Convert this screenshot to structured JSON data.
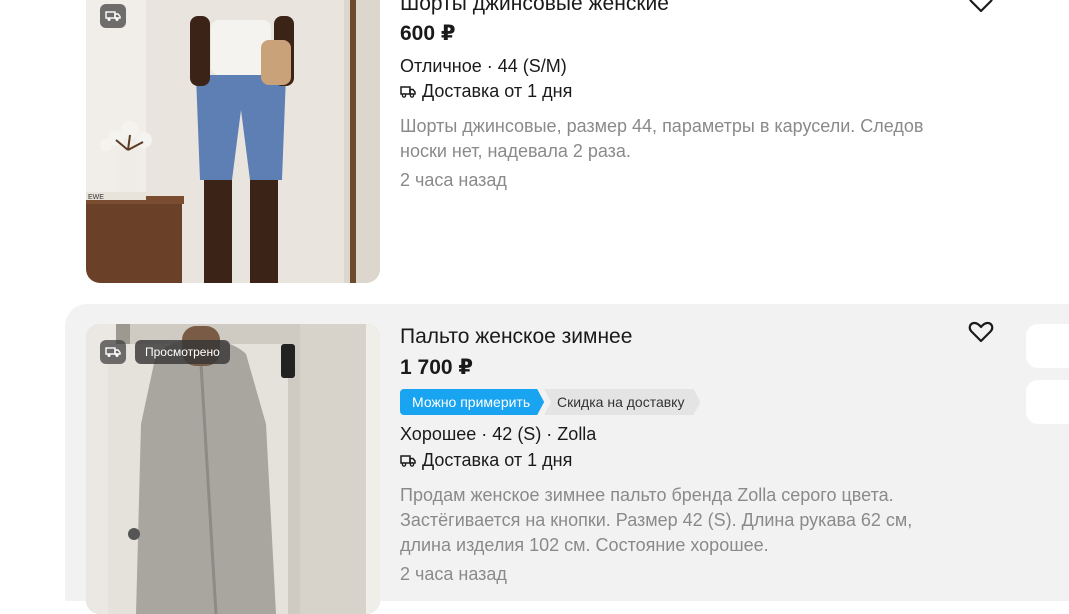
{
  "listings": [
    {
      "title": "Шорты джинсовые женские",
      "price": "600 ₽",
      "condition": "Отличное · 44 (S/M)",
      "delivery": "Доставка от 1 дня",
      "description_line1": "Шорты джинсовые, размер 44, параметры в карусели. Следов",
      "description_line2": "носки нет, надевала 2 раза.",
      "posted": "2 часа назад",
      "photo_label": "EWE"
    },
    {
      "title": "Пальто женское зимнее",
      "price": "1 700 ₽",
      "viewed_badge": "Просмотрено",
      "tags": [
        "Можно примерить",
        "Скидка на доставку"
      ],
      "condition": "Хорошее · 42 (S) · Zolla",
      "delivery": "Доставка от 1 дня",
      "description_line1": "Продам женское зимнее пальто бренда Zolla серого цвета.",
      "description_line2": "Застёгивается на кнопки. Размер 42 (S). Длина рукава 62 см,",
      "description_line3": "длина изделия 102 см. Состояние хорошее.",
      "posted": "2 часа назад"
    }
  ],
  "icons": {
    "delivery": "truck-icon",
    "favorite": "heart-icon"
  },
  "colors": {
    "accent_blue": "#18a4f0",
    "muted_text": "#8a8a8a",
    "card_bg": "#f2f2f2"
  }
}
